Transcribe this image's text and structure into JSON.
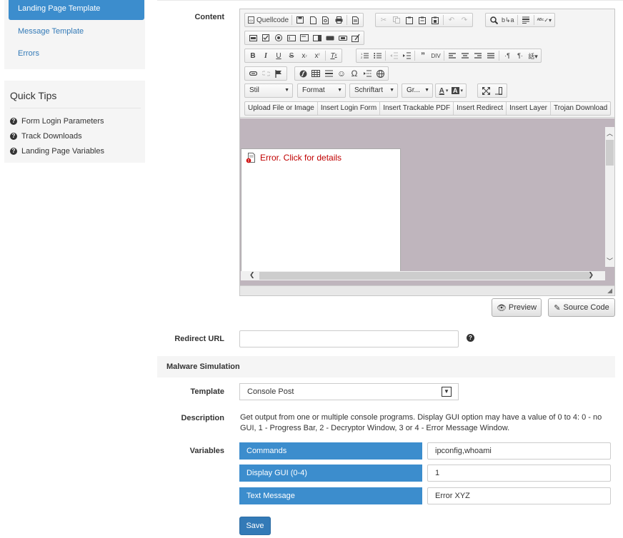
{
  "sidebar": {
    "nav": [
      {
        "label": "Landing Page Template",
        "active": true
      },
      {
        "label": "Message Template",
        "active": false
      },
      {
        "label": "Errors",
        "active": false
      }
    ],
    "tips_title": "Quick Tips",
    "tips": [
      "Form Login Parameters",
      "Track Downloads",
      "Landing Page Variables"
    ]
  },
  "form": {
    "content_label": "Content",
    "redirect_label": "Redirect URL",
    "redirect_value": "",
    "section_title": "Malware Simulation",
    "template_label": "Template",
    "template_value": "Console Post",
    "description_label": "Description",
    "description_text": "Get output from one or multiple console programs. Display GUI option may have a value of 0 to 4: 0 - no GUI, 1 - Progress Bar, 2 - Decryptor Window, 3 or 4 - Error Message Window.",
    "variables_label": "Variables",
    "variables": [
      {
        "name": "Commands",
        "value": "ipconfig,whoami"
      },
      {
        "name": "Display GUI (0-4)",
        "value": "1"
      },
      {
        "name": "Text Message",
        "value": "Error XYZ"
      }
    ],
    "save_label": "Save"
  },
  "editor": {
    "source_label": "Quellcode",
    "combos": [
      "Stil",
      "Format",
      "Schriftart",
      "Gr..."
    ],
    "custom_buttons": [
      "Upload File or Image",
      "Insert Login Form",
      "Insert Trackable PDF",
      "Insert Redirect",
      "Insert Layer",
      "Trojan Download"
    ],
    "error_text": "Error. Click for details",
    "preview_label": "Preview",
    "source_code_label": "Source Code"
  },
  "colors": {
    "accent": "#3c8dcd",
    "primary_button": "#337ab7",
    "editor_background": "#bfb5bd",
    "error_text": "#c00000"
  }
}
